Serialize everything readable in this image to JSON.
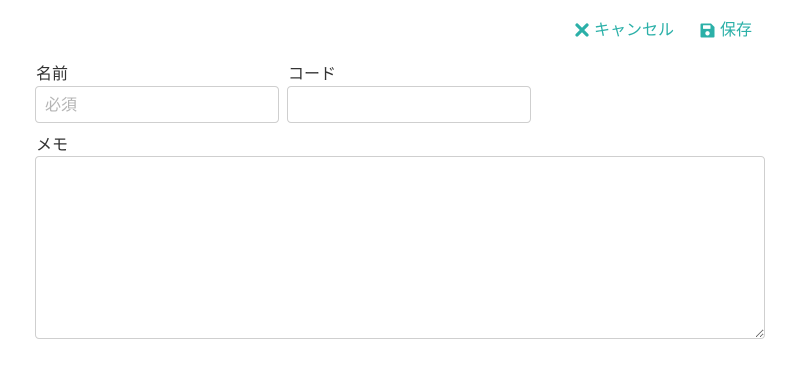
{
  "toolbar": {
    "cancel_label": "キャンセル",
    "cancel_icon": "close-icon",
    "save_label": "保存",
    "save_icon": "floppy-disk-icon",
    "accent_color": "#2bb0a8"
  },
  "form": {
    "name": {
      "label": "名前",
      "value": "",
      "placeholder": "必須"
    },
    "code": {
      "label": "コード",
      "value": "",
      "placeholder": ""
    },
    "memo": {
      "label": "メモ",
      "value": "",
      "placeholder": ""
    }
  }
}
